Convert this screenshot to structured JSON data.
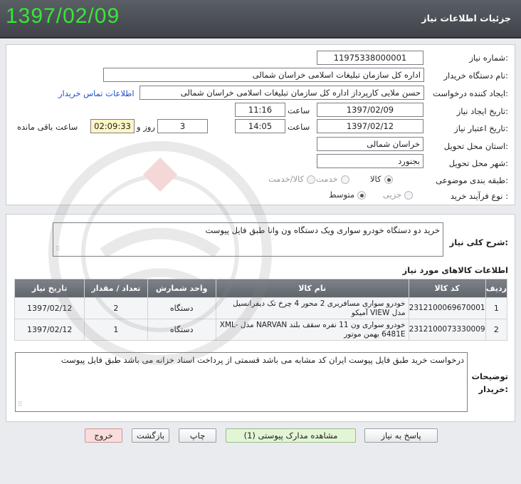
{
  "header": {
    "title": "جزئیات اطلاعات نیاز",
    "date": "1397/02/09"
  },
  "form": {
    "need_number": {
      "label": "شماره نیاز:",
      "value": "11975338000001"
    },
    "buyer_org": {
      "label": "نام دستگاه خریدار:",
      "value": "اداره کل سازمان تبلیغات اسلامی خراسان شمالی"
    },
    "requester": {
      "label": "ایجاد کننده درخواست:",
      "value": "حسن ملایی کارپرداز اداره کل سازمان تبلیغات اسلامی خراسان شمالی",
      "contact_link": "اطلاعات تماس خریدار"
    },
    "created": {
      "label": "تاریخ ایجاد نیاز:",
      "date": "1397/02/09",
      "time_label": "ساعت",
      "time": "11:16"
    },
    "validity": {
      "label": "تاریخ اعتبار نیاز:",
      "date": "1397/02/12",
      "time_label": "ساعت",
      "time": "14:05",
      "days": "3",
      "days_label": "روز و",
      "remaining": "02:09:33",
      "remaining_label": "ساعت باقی مانده"
    },
    "province": {
      "label": "استان محل تحویل:",
      "value": "خراسان شمالی"
    },
    "city": {
      "label": "شهر محل تحویل:",
      "value": "بجنورد"
    },
    "category": {
      "label": "طبقه بندی موضوعی:",
      "options": [
        "کالا",
        "خدمت",
        "کالا/خدمت"
      ],
      "selected": "کالا"
    },
    "process": {
      "label": "نوع فرآیند خرید :",
      "options": [
        "جزیی",
        "متوسط"
      ],
      "selected": "متوسط"
    }
  },
  "description": {
    "label": "شرح کلی نیاز:",
    "value": "خرید دو دستگاه خودرو سواری ویک دستگاه ون وانا طبق فایل پیوست"
  },
  "items": {
    "title": "اطلاعات کالاهای مورد نیاز",
    "columns": [
      "ردیف",
      "کد کالا",
      "نام کالا",
      "واحد شمارش",
      "تعداد / مقدار",
      "تاریخ نیاز"
    ],
    "rows": [
      {
        "row": "1",
        "code": "2312100069670001",
        "name": "خودرو سواری مسافربری 2 محور 4 چرخ تک دیفرانسیل مدل VIEW آمیکو",
        "unit": "دستگاه",
        "qty": "2",
        "date": "1397/02/12"
      },
      {
        "row": "2",
        "code": "2312100073330009",
        "name": "خودرو سواری ون 11 نفره سقف بلند NARVAN مدل XML-6481E بهمن موتور",
        "unit": "دستگاه",
        "qty": "1",
        "date": "1397/02/12"
      }
    ]
  },
  "buyer_notes": {
    "label_line1": "توضیحات",
    "label_line2": "خریدار:",
    "value": "درخواست خرید طبق فایل پیوست ایران کد مشابه می باشد قسمتی از پرداخت اسناد خزانه می باشد طبق فایل پیوست"
  },
  "buttons": {
    "reply": "پاسخ به نیاز",
    "attachments": "مشاهده مدارک پیوستی (1)",
    "print": "چاپ",
    "back": "بازگشت",
    "exit": "خروج"
  },
  "colors": {
    "header_bg": "#4a4e54",
    "header_date": "#36e836",
    "table_header": "#6e737a",
    "link": "#1f4fc9"
  }
}
